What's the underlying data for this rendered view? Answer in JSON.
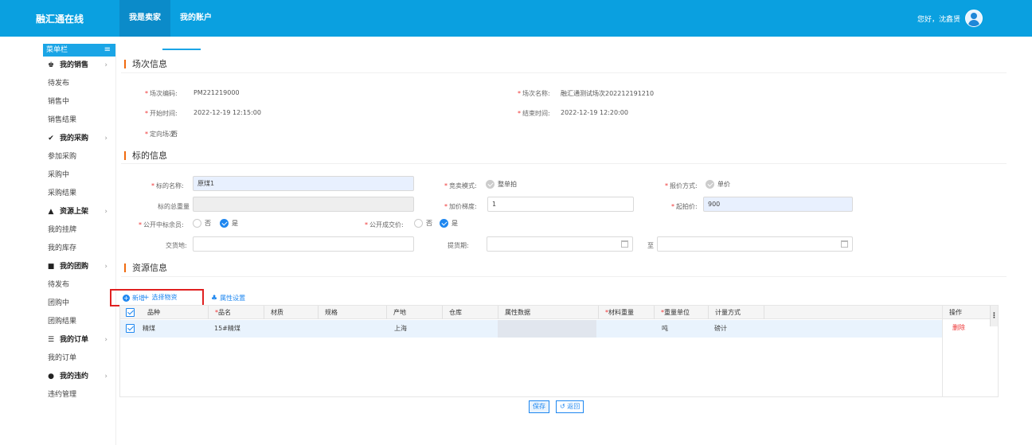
{
  "app": {
    "brand": "融汇通在线"
  },
  "nav": {
    "tabs": [
      {
        "label": "我是卖家"
      },
      {
        "label": "我的账户"
      }
    ]
  },
  "user": {
    "greeting": "您好，沈鑫贤"
  },
  "sidebar": {
    "header": "菜单栏",
    "groups": [
      {
        "label": "我的销售",
        "items": [
          "待发布",
          "销售中",
          "销售结果"
        ]
      },
      {
        "label": "我的采购",
        "items": [
          "参加采购",
          "采购中",
          "采购结果"
        ]
      },
      {
        "label": "资源上架",
        "items": [
          "我的挂牌",
          "我的库存"
        ]
      },
      {
        "label": "我的团购",
        "items": [
          "待发布",
          "团购中",
          "团购结果"
        ]
      },
      {
        "label": "我的订单",
        "items": [
          "我的订单"
        ]
      },
      {
        "label": "我的违约",
        "items": [
          "违约管理"
        ]
      }
    ]
  },
  "session": {
    "title": "场次信息",
    "code_label": "场次编码:",
    "code": "PM221219000",
    "name_label": "场次名称:",
    "name": "融汇通测试场次202212191210",
    "start_label": "开始时间:",
    "start": "2022-12-19 12:15:00",
    "end_label": "结束时间:",
    "end": "2022-12-19 12:20:00",
    "directed_label": "定向场次:",
    "directed": "否"
  },
  "lot": {
    "title": "标的信息",
    "name_label": "标的名称:",
    "name": "原煤1",
    "mode_label": "竞卖模式:",
    "mode": "整单拍",
    "quote_label": "报价方式:",
    "quote": "单价",
    "total_label": "标的总重量",
    "step_label": "加价梯度:",
    "step": "1",
    "start_price_label": "起拍价:",
    "start_price": "900",
    "public_bidder_label": "公开中标余员:",
    "public_deal_label": "公开成交价:",
    "no": "否",
    "yes": "是",
    "delivery_label": "交货地:",
    "pickup_label": "提货期:",
    "to": "至"
  },
  "resource": {
    "title": "资源信息",
    "add_label": "新增",
    "select_label": "选择物资",
    "attr_label": "属性设置",
    "columns": [
      "品种",
      "品名",
      "材质",
      "规格",
      "产地",
      "仓库",
      "属性数据",
      "材料重量",
      "重量单位",
      "计量方式",
      "操作"
    ],
    "req_mark": "*",
    "row": {
      "variety": "精煤",
      "product": "15#精煤",
      "material": "",
      "spec": "",
      "origin": "上海",
      "warehouse": "",
      "attr": "",
      "weight": "",
      "unit": "吨",
      "measure": "磅计",
      "op": "删除"
    }
  },
  "actions": {
    "save": "保存",
    "back": "返回"
  }
}
